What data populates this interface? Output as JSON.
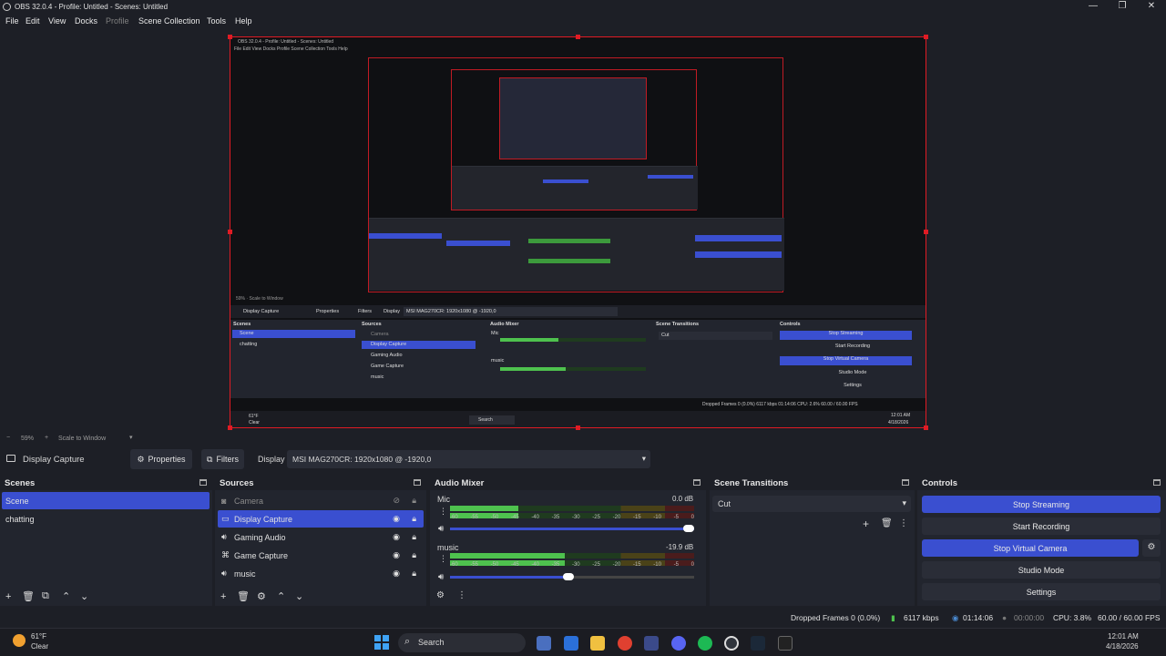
{
  "window": {
    "title": "OBS 32.0.4 - Profile: Untitled - Scenes: Untitled"
  },
  "menu": [
    "File",
    "Edit",
    "View",
    "Docks",
    "Profile",
    "Scene Collection",
    "Tools",
    "Help"
  ],
  "zoom": {
    "value": "59%",
    "label": "Scale to Window"
  },
  "source_toolbar": {
    "source": "Display Capture",
    "properties": "Properties",
    "filters": "Filters",
    "display_label": "Display",
    "display_value": "MSI MAG270CR: 1920x1080 @ -1920,0"
  },
  "scenes": {
    "title": "Scenes",
    "items": [
      "Scene",
      "chatting"
    ]
  },
  "sources": {
    "title": "Sources",
    "items": [
      "Camera",
      "Display Capture",
      "Gaming Audio",
      "Game Capture",
      "music"
    ]
  },
  "mixer": {
    "title": "Audio Mixer",
    "channels": [
      {
        "name": "Mic",
        "db": "0.0 dB",
        "level": 0.28
      },
      {
        "name": "music",
        "db": "-19.9 dB",
        "level": 0.47
      }
    ],
    "ticks": [
      "-60",
      "-55",
      "-50",
      "-45",
      "-40",
      "-35",
      "-30",
      "-25",
      "-20",
      "-15",
      "-10",
      "-5",
      "0"
    ]
  },
  "transitions": {
    "title": "Scene Transitions",
    "current": "Cut"
  },
  "controls": {
    "title": "Controls",
    "buttons": [
      "Stop Streaming",
      "Start Recording",
      "Stop Virtual Camera",
      "Studio Mode",
      "Settings"
    ]
  },
  "status": {
    "dropped": "Dropped Frames 0 (0.0%)",
    "kbps": "6117 kbps",
    "stream_time": "01:14:06",
    "rec_time": "00:00:00",
    "cpu": "CPU: 3.8%",
    "fps": "60.00 / 60.00 FPS"
  },
  "taskbar": {
    "weather_temp": "61°F",
    "weather_desc": "Clear",
    "search": "Search",
    "time": "12:01 AM",
    "date": "4/18/2026"
  },
  "nested": {
    "title": "OBS 32.0.4 - Profile: Untitled - Scenes: Untitled",
    "menu": "File  Edit  View  Docks  Profile  Scene Collection  Tools  Help",
    "zoom": "59%  ·  Scale to Window",
    "src": "Display Capture",
    "props": "Properties",
    "filters": "Filters",
    "display": "Display",
    "display_value": "MSI MAG270CR: 1920x1080 @ -1920,0",
    "scenes": "Scenes",
    "sources": "Sources",
    "mixer": "Audio Mixer",
    "trans": "Scene Transitions",
    "controls": "Controls",
    "scene_items": [
      "Scene",
      "chatting"
    ],
    "source_items": [
      "Camera",
      "Display Capture",
      "Gaming Audio",
      "Game Capture",
      "music"
    ],
    "mic": "Mic",
    "music": "music",
    "cut": "Cut",
    "ctl": [
      "Stop Streaming",
      "Start Recording",
      "Stop Virtual Camera",
      "Studio Mode",
      "Settings"
    ],
    "status": "Dropped Frames 0 (0.0%)   6117 kbps   01:14:06   CPU: 2.6%   60.00 / 60.00 FPS",
    "temp": "61°F",
    "clear": "Clear",
    "search": "Search",
    "time": "12:01 AM",
    "date": "4/18/2026"
  }
}
